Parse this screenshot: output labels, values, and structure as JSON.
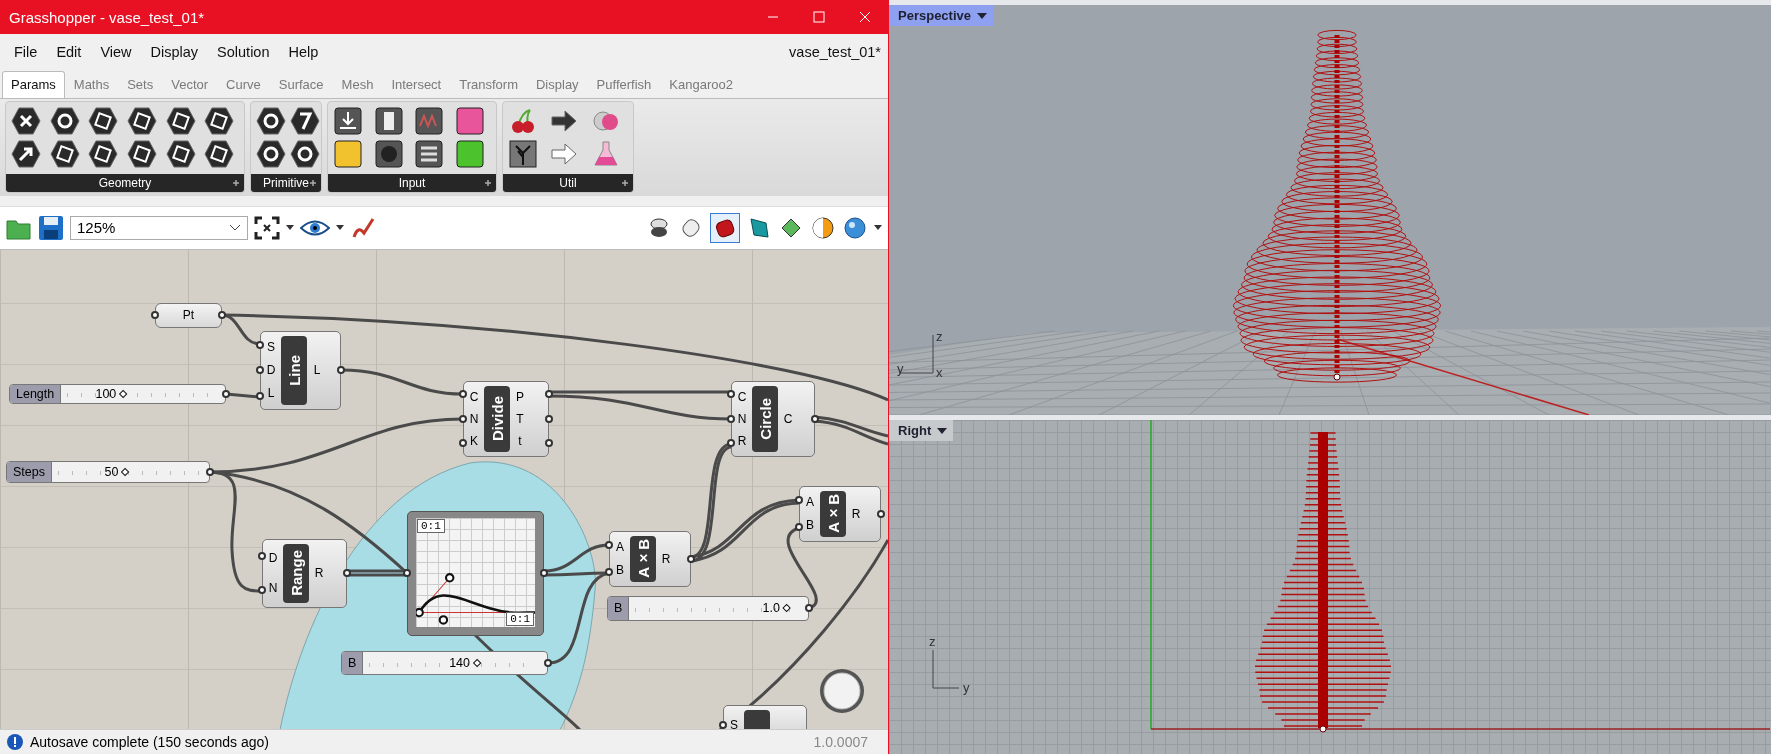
{
  "window": {
    "title": "Grasshopper - vase_test_01*"
  },
  "menu": {
    "items": [
      "File",
      "Edit",
      "View",
      "Display",
      "Solution",
      "Help"
    ],
    "document": "vase_test_01*"
  },
  "tabs": [
    {
      "label": "Params",
      "selected": true
    },
    {
      "label": "Maths",
      "selected": false
    },
    {
      "label": "Sets",
      "selected": false
    },
    {
      "label": "Vector",
      "selected": false
    },
    {
      "label": "Curve",
      "selected": false
    },
    {
      "label": "Surface",
      "selected": false
    },
    {
      "label": "Mesh",
      "selected": false
    },
    {
      "label": "Intersect",
      "selected": false
    },
    {
      "label": "Transform",
      "selected": false
    },
    {
      "label": "Display",
      "selected": false
    },
    {
      "label": "Pufferfish",
      "selected": false
    },
    {
      "label": "Kangaroo2",
      "selected": false
    }
  ],
  "ribbon": {
    "groups": [
      "Geometry",
      "Primitive",
      "Input",
      "Util"
    ]
  },
  "toolbar": {
    "zoom": "125%"
  },
  "canvas": {
    "nodes": [
      {
        "kind": "param",
        "name": "Pt"
      },
      {
        "kind": "component",
        "name": "Line",
        "inputs": [
          "S",
          "D",
          "L"
        ],
        "outputs": [
          "L"
        ]
      },
      {
        "kind": "slider",
        "label": "Length",
        "value": "100",
        "level": 0.4
      },
      {
        "kind": "component",
        "name": "Divide",
        "inputs": [
          "C",
          "N",
          "K"
        ],
        "outputs": [
          "P",
          "T",
          "t"
        ]
      },
      {
        "kind": "component",
        "name": "Circle",
        "inputs": [
          "C",
          "N",
          "R"
        ],
        "outputs": [
          "C"
        ]
      },
      {
        "kind": "slider",
        "label": "Steps",
        "value": "50",
        "level": 0.5
      },
      {
        "kind": "component",
        "name": "A×B",
        "inputs": [
          "A",
          "B"
        ],
        "outputs": [
          "R"
        ]
      },
      {
        "kind": "component",
        "name": "Range",
        "inputs": [
          "D",
          "N"
        ],
        "outputs": [
          "R"
        ]
      },
      {
        "kind": "graph",
        "labels": [
          "0:1",
          "0:1"
        ]
      },
      {
        "kind": "component",
        "name": "A×B",
        "inputs": [
          "A",
          "B"
        ],
        "outputs": [
          "R"
        ]
      },
      {
        "kind": "slider",
        "label": "B",
        "value": "1.0",
        "level": 0.95
      },
      {
        "kind": "slider",
        "label": "B",
        "value": "140",
        "level": 0.66
      },
      {
        "kind": "component",
        "inputs": [
          "S"
        ]
      }
    ]
  },
  "status_bar": {
    "message": "Autosave complete (150 seconds ago)",
    "version": "1.0.0007"
  },
  "viewports": [
    {
      "kind": "perspective",
      "label": "Perspective",
      "selected": true,
      "axes": [
        "z",
        "y",
        "x"
      ]
    },
    {
      "kind": "right",
      "label": "Right",
      "selected": false,
      "axes": [
        "z",
        "y"
      ]
    }
  ]
}
